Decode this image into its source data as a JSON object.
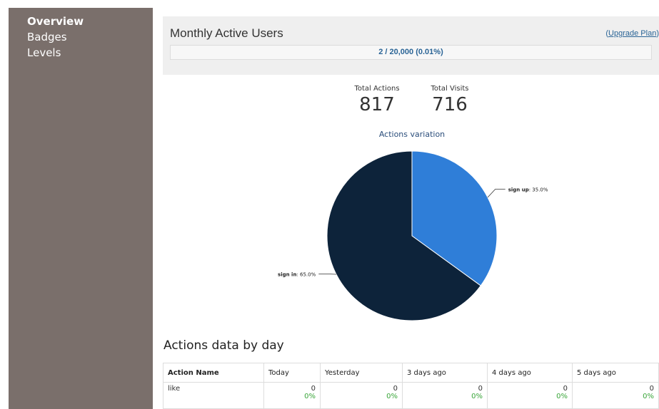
{
  "sidebar": {
    "items": [
      {
        "label": "Overview",
        "active": true
      },
      {
        "label": "Badges",
        "active": false
      },
      {
        "label": "Levels",
        "active": false
      }
    ]
  },
  "mau": {
    "title": "Monthly Active Users",
    "upgrade_prefix": "(",
    "upgrade_link": "Upgrade Plan",
    "upgrade_suffix": ")",
    "usage": "2 / 20,000 (0.01%)"
  },
  "stats": {
    "total_actions_label": "Total Actions",
    "total_actions": "817",
    "total_visits_label": "Total Visits",
    "total_visits": "716"
  },
  "chart_data": {
    "type": "pie",
    "title": "Actions variation",
    "slices": [
      {
        "name": "sign up",
        "value": 35.0,
        "label_value": "35.0%",
        "color": "#2f7ed8"
      },
      {
        "name": "sign in",
        "value": 65.0,
        "label_value": "65.0%",
        "color": "#0d233a"
      }
    ]
  },
  "table": {
    "title": "Actions data by day",
    "columns": [
      "Action Name",
      "Today",
      "Yesterday",
      "3 days ago",
      "4 days ago",
      "5 days ago"
    ],
    "rows": [
      {
        "name": "like",
        "cells": [
          {
            "count": "0",
            "pct": "0%"
          },
          {
            "count": "0",
            "pct": "0%"
          },
          {
            "count": "0",
            "pct": "0%"
          },
          {
            "count": "0",
            "pct": "0%"
          },
          {
            "count": "0",
            "pct": "0%"
          }
        ]
      }
    ]
  }
}
